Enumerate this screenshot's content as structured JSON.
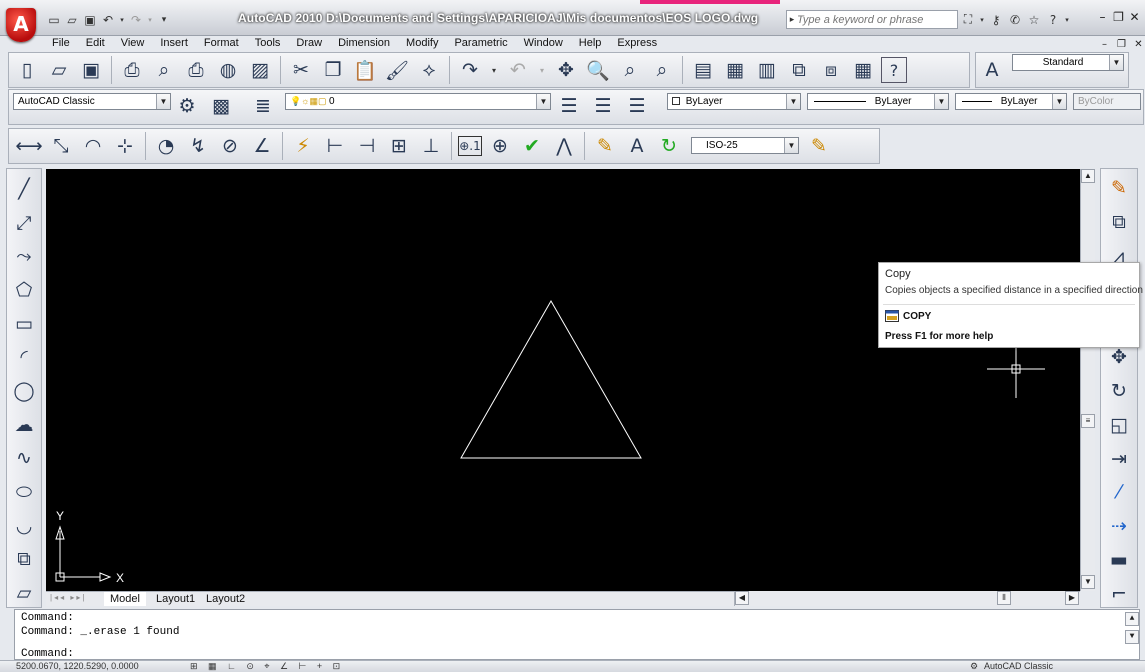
{
  "app": {
    "logo_letter": "A",
    "window_title": "AutoCAD 2010    D:\\Documents and Settings\\APARICIOAJ\\Mis documentos\\EOS LOGO.dwg",
    "search_placeholder": "Type a keyword or phrase"
  },
  "menubar": {
    "items": [
      "File",
      "Edit",
      "View",
      "Insert",
      "Format",
      "Tools",
      "Draw",
      "Dimension",
      "Modify",
      "Parametric",
      "Window",
      "Help",
      "Express"
    ]
  },
  "toolbar_props": {
    "workspace": "AutoCAD Classic",
    "layer": "0",
    "color": "ByLayer",
    "linetype": "ByLayer",
    "lineweight": "ByLayer",
    "plotstyle": "ByColor"
  },
  "text_style": "Standard",
  "dim_style": "ISO-25",
  "layout_tabs": [
    "Model",
    "Layout1",
    "Layout2"
  ],
  "ucs": {
    "x_label": "X",
    "y_label": "Y"
  },
  "command_window": {
    "lines": [
      "Command:",
      "Command: _.erase 1 found",
      "Command:"
    ]
  },
  "statusbar": {
    "coords": "5200.0670, 1220.5290, 0.0000",
    "workspace": "AutoCAD Classic"
  },
  "tooltip": {
    "title": "Copy",
    "description": "Copies objects a specified distance in a specified direction",
    "command": "COPY",
    "help": "Press F1 for more help"
  },
  "colors": {
    "canvas": "#000000",
    "drawing_line": "#ffffff",
    "title_text": "#ffffff",
    "accent_pink": "#e8247c",
    "app_red": "#c81414"
  },
  "icons": {
    "qat": [
      "new-icon",
      "open-icon",
      "save-icon",
      "undo-icon",
      "redo-icon",
      "dropdown-icon"
    ],
    "standard_toolbar": [
      "qnew-icon",
      "open-icon",
      "save-icon",
      "plot-icon",
      "plot-preview-icon",
      "publish-icon",
      "3d-dwf-icon",
      "sheet-set-icon",
      "cut-icon",
      "copy-clip-icon",
      "paste-icon",
      "match-properties-icon",
      "block-editor-icon",
      "redo-icon",
      "undo-icon",
      "pan-icon",
      "zoom-realtime-icon",
      "zoom-window-icon",
      "zoom-previous-icon",
      "properties-icon",
      "design-center-icon",
      "tool-palettes-icon",
      "sheet-set-manager-icon",
      "markup-icon",
      "quickcalc-icon",
      "help-icon"
    ],
    "draw_toolbar": [
      "line-icon",
      "construction-line-icon",
      "polyline-icon",
      "polygon-icon",
      "rectangle-icon",
      "arc-icon",
      "circle-icon",
      "revision-cloud-icon",
      "spline-icon",
      "ellipse-icon",
      "ellipse-arc-icon",
      "insert-block-icon",
      "make-block-icon"
    ],
    "modify_toolbar": [
      "erase-icon",
      "copy-icon",
      "mirror-icon",
      "move-icon",
      "rotate-icon",
      "scale-icon",
      "stretch-icon",
      "trim-icon",
      "extend-icon",
      "break-icon",
      "fillet-icon"
    ]
  }
}
